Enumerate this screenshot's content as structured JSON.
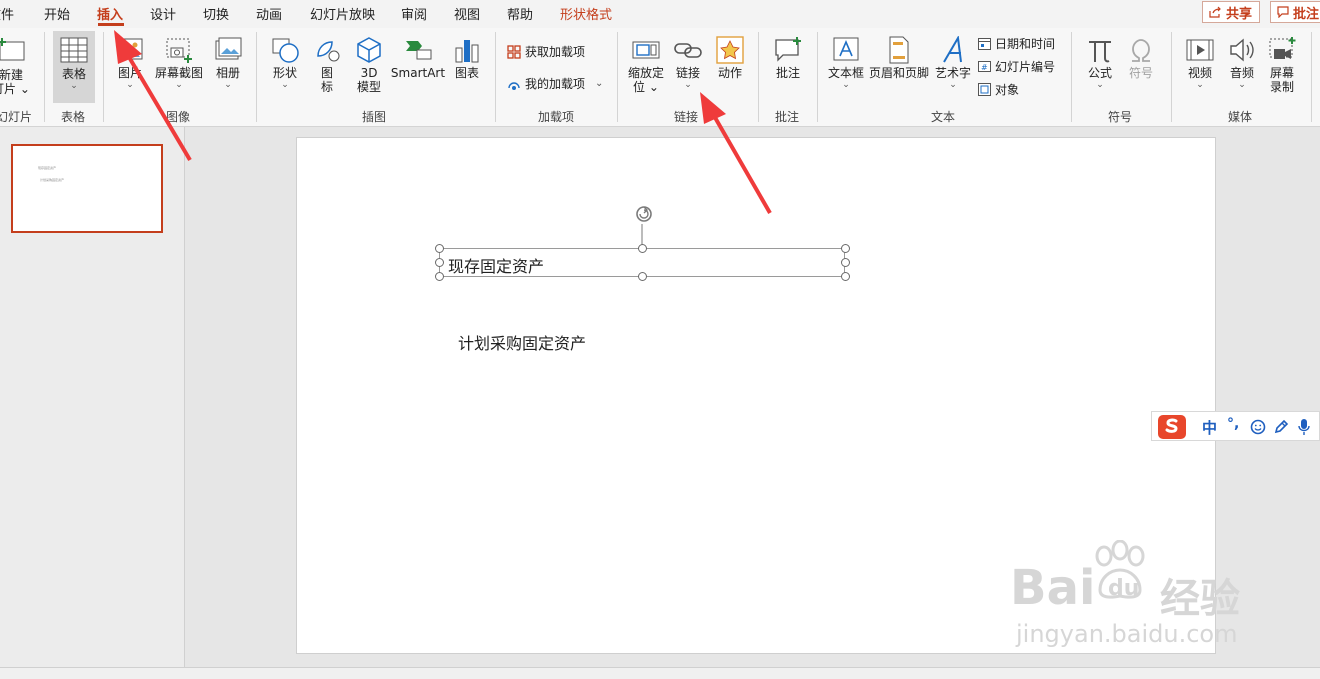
{
  "menubar": {
    "tabs": [
      "文件",
      "开始",
      "插入",
      "设计",
      "切换",
      "动画",
      "幻灯片放映",
      "审阅",
      "视图",
      "帮助",
      "形状格式"
    ],
    "partial_file": "文件",
    "share": "共享",
    "comments": "批注"
  },
  "ribbon": {
    "slides": {
      "new_slide": "新建幻灯片",
      "new_l1": "新建",
      "new_l2": "灯片",
      "group": "幻灯片"
    },
    "table": {
      "label": "表格",
      "group": "表格"
    },
    "images": {
      "picture": "图片",
      "screenshot": "屏幕截图",
      "album": "相册",
      "group": "图像"
    },
    "illustrations": {
      "shapes": "形状",
      "icons_l1": "图",
      "icons_l2": "标",
      "model_l1": "3D",
      "model_l2": "模型",
      "smartart": "SmartArt",
      "chart": "图表",
      "group": "插图"
    },
    "addins": {
      "get": "获取加载项",
      "mine": "我的加载项",
      "group": "加载项"
    },
    "links": {
      "zoom_l1": "缩放定",
      "zoom_l2": "位",
      "link": "链接",
      "action": "动作",
      "group": "链接"
    },
    "comments": {
      "comment": "批注",
      "group": "批注"
    },
    "text": {
      "textbox": "文本框",
      "header_footer": "页眉和页脚",
      "wordart": "艺术字",
      "datetime": "日期和时间",
      "slide_number": "幻灯片编号",
      "object": "对象",
      "group": "文本"
    },
    "symbols": {
      "equation": "公式",
      "symbol": "符号",
      "group": "符号"
    },
    "media": {
      "video": "视频",
      "audio": "音频",
      "record_l1": "屏幕",
      "record_l2": "录制",
      "group": "媒体"
    }
  },
  "slide": {
    "textbox_text": "现存固定资产",
    "body_text": "计划采购固定资产"
  },
  "thumbnail": {
    "line1": "现存固定资产",
    "line2": "计划采购固定资产"
  },
  "ime": {
    "mode": "中",
    "punct": "°,"
  },
  "watermark": {
    "brand": "Bai",
    "brand2": "du",
    "cn": "经验",
    "url": "jingyan.baidu.com"
  },
  "colors": {
    "accent": "#c43e1c",
    "arrow": "#ef3b3b"
  }
}
